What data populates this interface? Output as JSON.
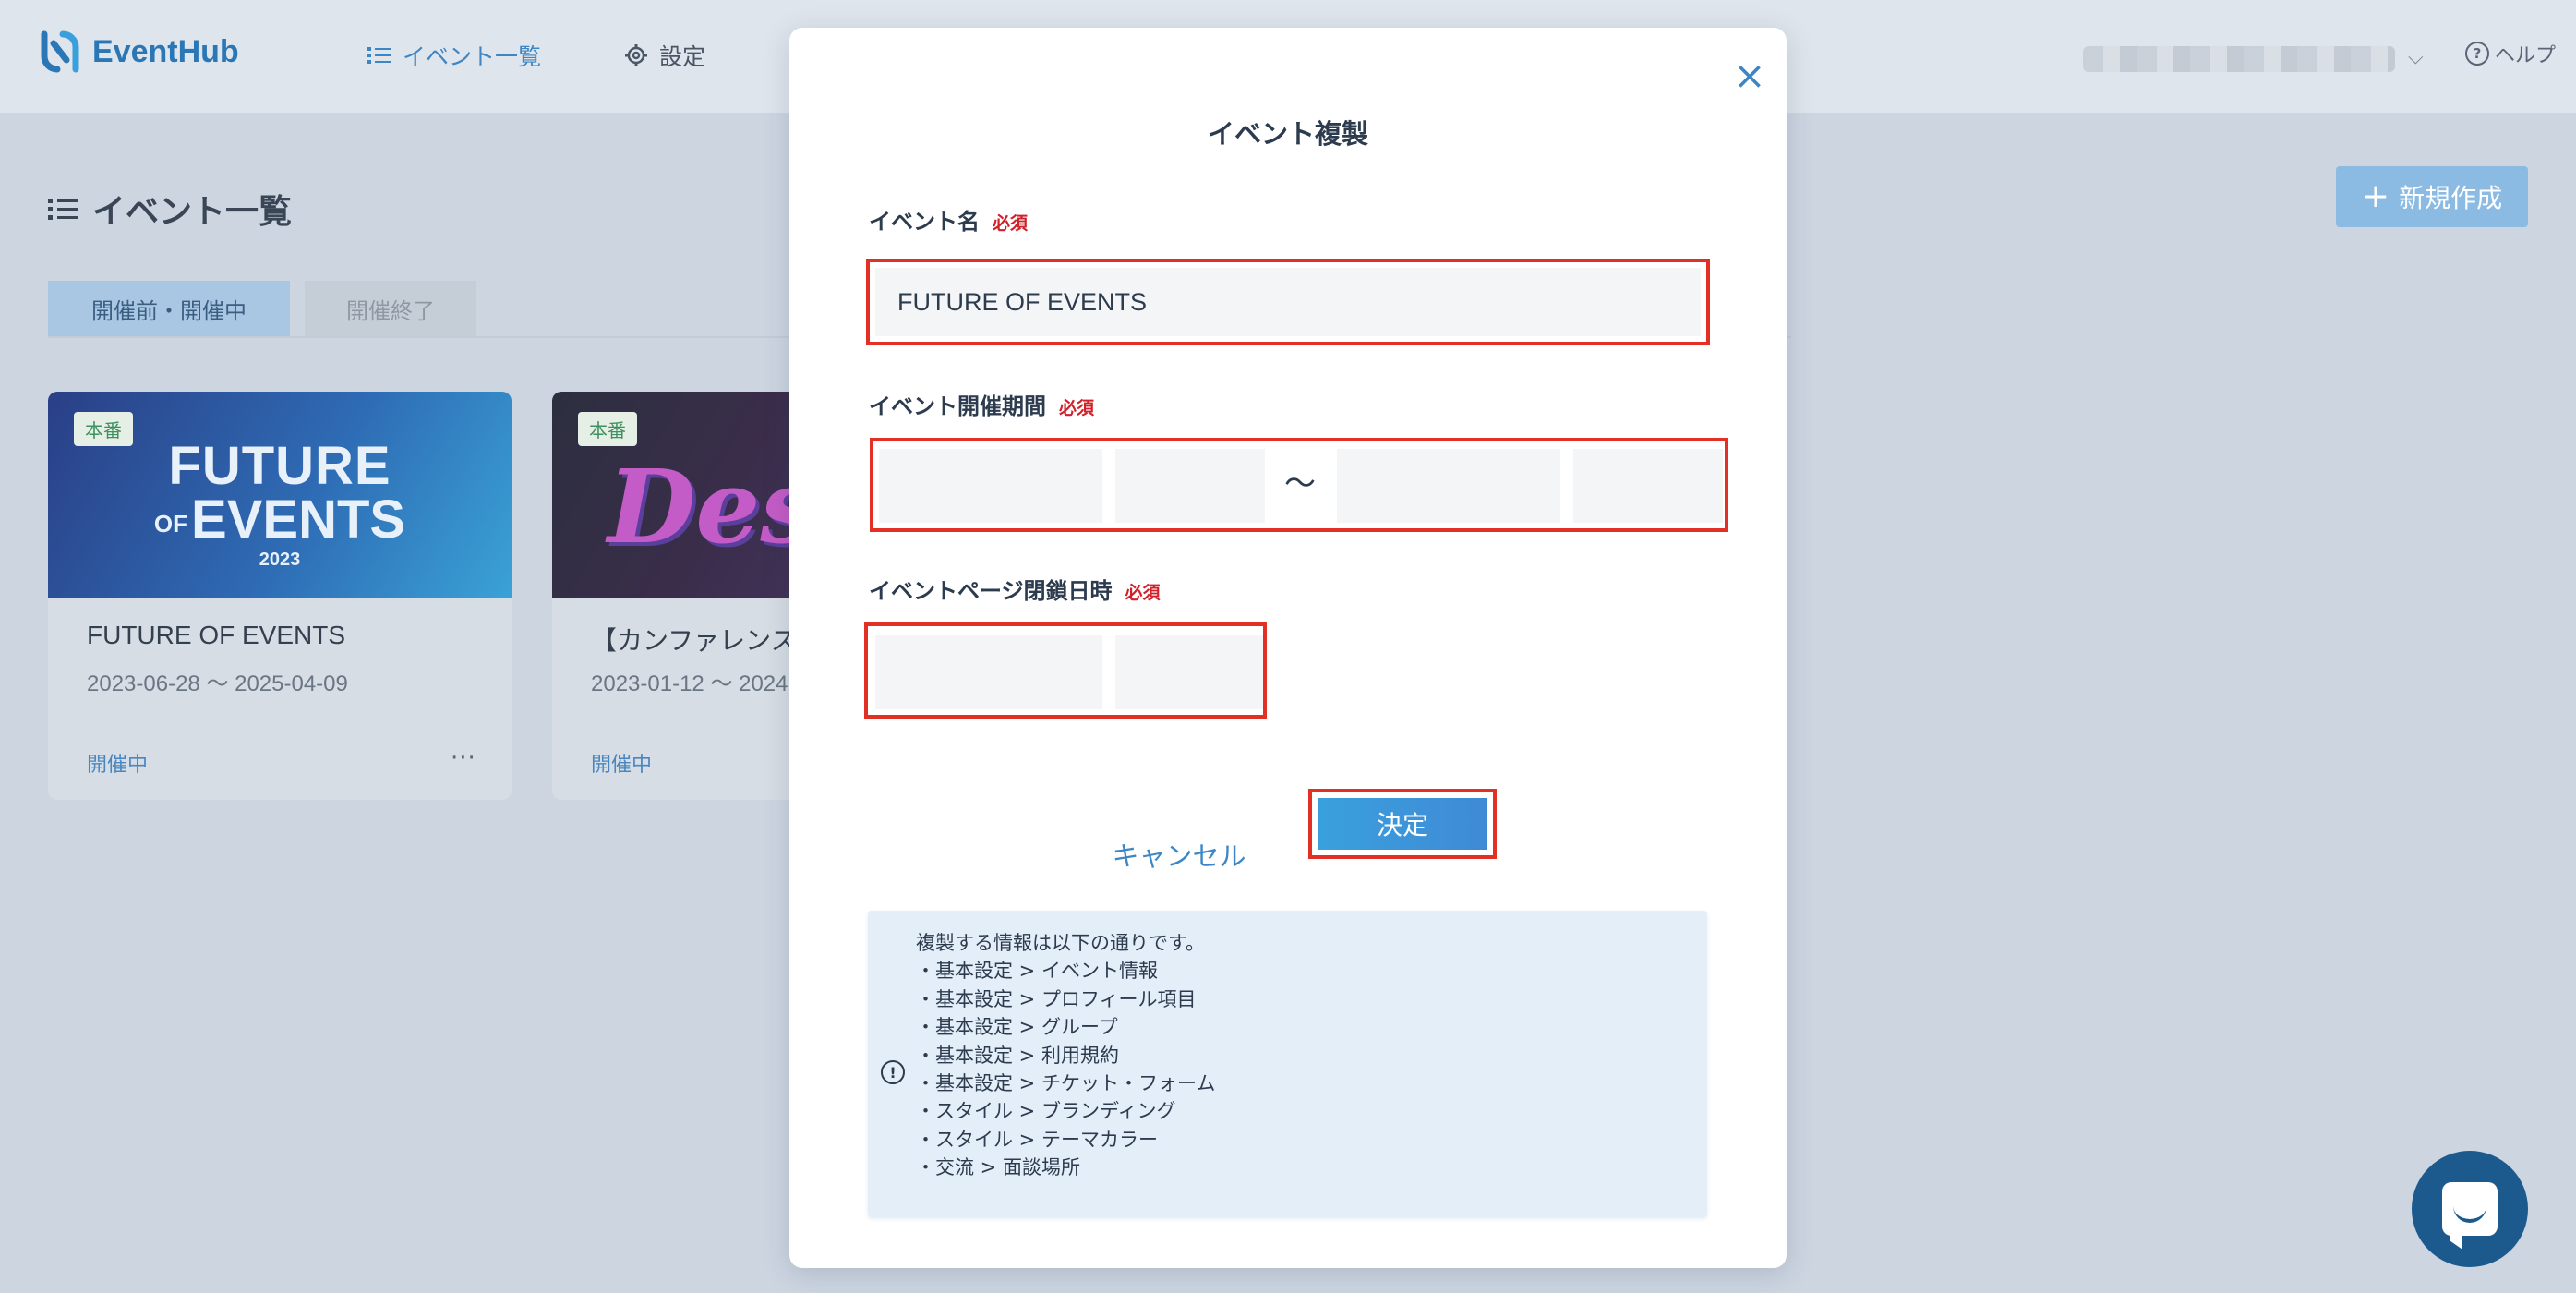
{
  "header": {
    "logo_text": "EventHub",
    "nav": [
      {
        "label": "イベント一覧",
        "icon": "list-icon"
      },
      {
        "label": "設定",
        "icon": "gear-icon"
      }
    ],
    "help_label": "ヘルプ"
  },
  "page": {
    "title": "イベント一覧",
    "new_button_label": "新規作成",
    "tabs": [
      {
        "label": "開催前・開催中",
        "active": true
      },
      {
        "label": "開催終了",
        "active": false
      }
    ],
    "cards": [
      {
        "badge": "本番",
        "hero_line1": "FUTURE",
        "hero_of": "OF",
        "hero_line2": "EVENTS",
        "hero_year": "2023",
        "title": "FUTURE OF EVENTS",
        "dates": "2023-06-28 ～ 2025-04-09",
        "status": "開催中",
        "menu": "···"
      },
      {
        "badge": "本番",
        "hero_art": "Desig",
        "title": "【カンファレンス】",
        "dates": "2023-01-12 ～ 2024",
        "status": "開催中"
      }
    ]
  },
  "modal": {
    "title": "イベント複製",
    "close_icon": "close-icon",
    "event_name_label": "イベント名",
    "required_label": "必須",
    "event_name_value": "FUTURE OF EVENTS",
    "period_label": "イベント開催期間",
    "period_separator": "～",
    "page_close_label": "イベントページ閉鎖日時",
    "cancel_label": "キャンセル",
    "confirm_label": "決定",
    "info_lines": [
      "複製する情報は以下の通りです。",
      "・基本設定 > イベント情報",
      "・基本設定 > プロフィール項目",
      "・基本設定 > グループ",
      "・基本設定 > 利用規約",
      "・基本設定 > チケット・フォーム",
      "・スタイル > ブランディング",
      "・スタイル > テーマカラー",
      "・交流 > 面談場所"
    ]
  },
  "colors": {
    "accent": "#3a86c7",
    "required": "#d0212a",
    "highlight_border": "#e33024",
    "confirm_button": "#3f8ad6"
  }
}
